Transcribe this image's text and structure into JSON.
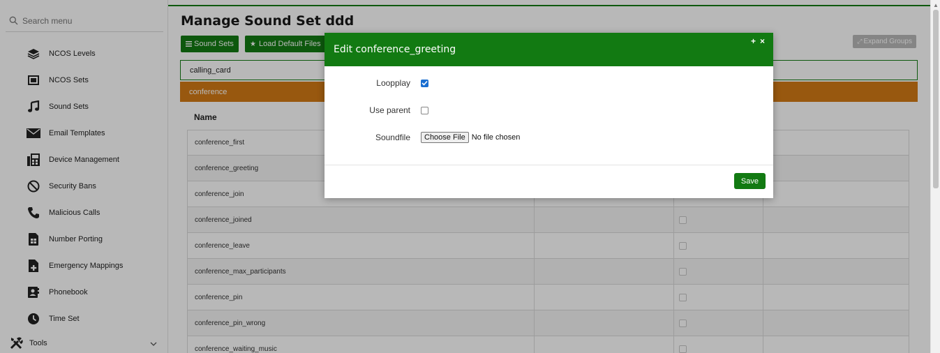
{
  "sidebar": {
    "search_placeholder": "Search menu",
    "items": [
      {
        "label": "NCOS Levels",
        "icon": "layers-icon"
      },
      {
        "label": "NCOS Sets",
        "icon": "crop-icon"
      },
      {
        "label": "Sound Sets",
        "icon": "music-note-icon"
      },
      {
        "label": "Email Templates",
        "icon": "envelope-icon"
      },
      {
        "label": "Device Management",
        "icon": "fax-icon"
      },
      {
        "label": "Security Bans",
        "icon": "ban-icon"
      },
      {
        "label": "Malicious Calls",
        "icon": "phone-icon"
      },
      {
        "label": "Number Porting",
        "icon": "sim-card-icon"
      },
      {
        "label": "Emergency Mappings",
        "icon": "medical-file-icon"
      },
      {
        "label": "Phonebook",
        "icon": "contact-book-icon"
      },
      {
        "label": "Time Set",
        "icon": "clock-icon"
      }
    ],
    "tools_label": "Tools"
  },
  "main": {
    "title": "Manage Sound Set ddd",
    "buttons": {
      "sound_sets": "Sound Sets",
      "load_default": "Load Default Files",
      "expand_groups": "Expand Groups"
    },
    "groups": {
      "calling_card": "calling_card",
      "conference": "conference"
    },
    "table": {
      "header_name": "Name",
      "rows": [
        "conference_first",
        "conference_greeting",
        "conference_join",
        "conference_joined",
        "conference_leave",
        "conference_max_participants",
        "conference_pin",
        "conference_pin_wrong",
        "conference_waiting_music"
      ]
    }
  },
  "modal": {
    "title": "Edit conference_greeting",
    "expand_glyph": "+",
    "close_glyph": "×",
    "loopplay_label": "Loopplay",
    "loopplay_checked": true,
    "use_parent_label": "Use parent",
    "use_parent_checked": false,
    "soundfile_label": "Soundfile",
    "choose_file_label": "Choose File",
    "no_file_text": "No file chosen",
    "save_label": "Save"
  },
  "colors": {
    "accent_green": "#127a12",
    "conference_orange": "#d37b16"
  }
}
